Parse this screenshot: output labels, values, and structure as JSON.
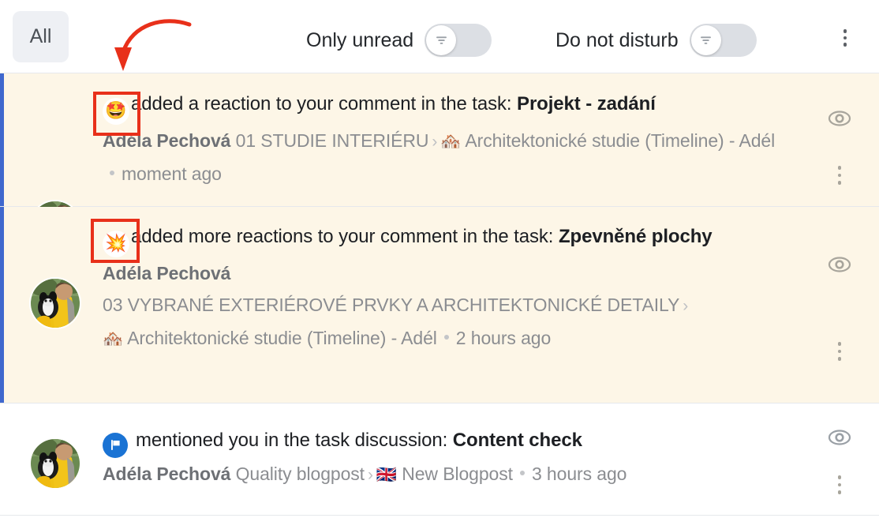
{
  "toolbar": {
    "all_filter_label": "All",
    "only_unread_label": "Only unread",
    "only_unread_state": "off",
    "do_not_disturb_label": "Do not disturb",
    "do_not_disturb_state": "off",
    "more_menu_icon": "kebab-menu-icon",
    "toggle_knob_icon": "filter-funnel-icon"
  },
  "annotations": {
    "arrow_color": "#e8301a",
    "box_color": "#e8301a",
    "arrow_name": "red-curved-arrow",
    "box_1_target": "reaction-emoji-badge-row-1",
    "box_2_target": "reaction-emoji-badge-row-2"
  },
  "colors": {
    "unread_background": "#fdf6e7",
    "unread_accent_bar": "#3f68ce",
    "read_background": "#ffffff",
    "flag_badge": "#1a73d4",
    "chip_background": "#eef0f4"
  },
  "notifications": [
    {
      "unread": true,
      "emoji_badge": "🤩",
      "emoji_badge_name": "star-struck-emoji",
      "headline_text": "added a reaction to your comment in the task:",
      "task_name": "Projekt - zadání",
      "author": "Adéla Pechová",
      "breadcrumb_1": "01 STUDIE INTERIÉRU",
      "breadcrumb_2_emoji": "🏘️",
      "breadcrumb_2": "Architektonické studie (Timeline) - Adél",
      "timestamp": "moment ago",
      "eye_icon": "mark-as-read-eye-icon",
      "more_icon": "kebab-menu-icon",
      "avatar_name": "user-avatar-adela-pechova"
    },
    {
      "unread": true,
      "emoji_badge": "💥",
      "emoji_badge_name": "collision-emoji",
      "headline_text": "added more reactions to your comment in the task:",
      "task_name": "Zpevněné plochy",
      "author": "Adéla Pechová",
      "breadcrumb_1": "03 VYBRANÉ EXTERIÉROVÉ PRVKY A ARCHITEKTONICKÉ DETAILY",
      "breadcrumb_2_emoji": "🏘️",
      "breadcrumb_2": "Architektonické studie (Timeline) - Adél",
      "timestamp": "2 hours ago",
      "eye_icon": "mark-as-read-eye-icon",
      "more_icon": "kebab-menu-icon",
      "avatar_name": "user-avatar-adela-pechova"
    },
    {
      "unread": false,
      "emoji_badge": "🚩",
      "emoji_badge_name": "flag-badge-icon",
      "headline_text": "mentioned you in the task discussion:",
      "task_name": "Content check",
      "author": "Adéla Pechová",
      "breadcrumb_1": "Quality blogpost",
      "breadcrumb_2_emoji": "🇬🇧",
      "breadcrumb_2": "New Blogpost",
      "timestamp": "3 hours ago",
      "eye_icon": "mark-as-read-eye-icon",
      "more_icon": "kebab-menu-icon",
      "avatar_name": "user-avatar-adela-pechova"
    }
  ]
}
